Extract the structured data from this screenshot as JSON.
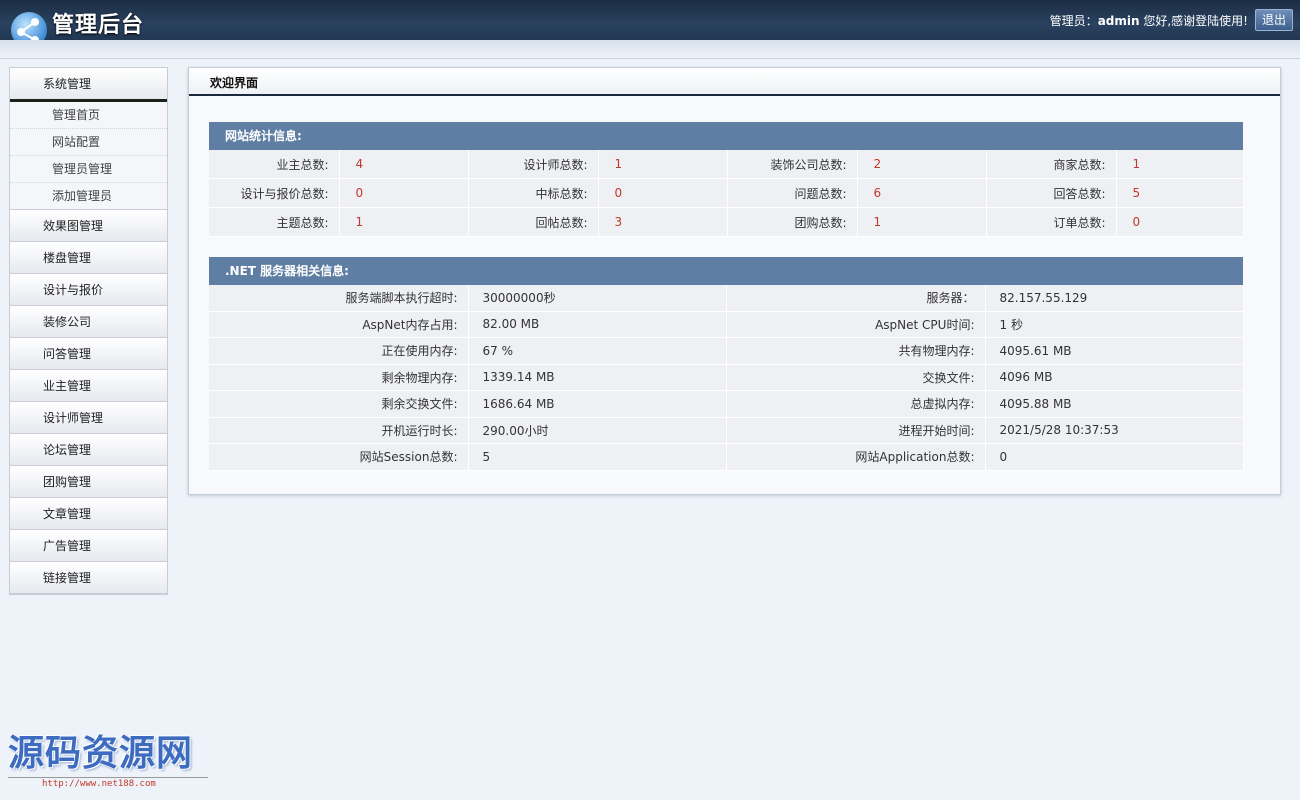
{
  "header": {
    "app_title": "管理后台",
    "welcome_prefix": "管理员：",
    "username": "admin",
    "welcome_suffix": " 您好,感谢登陆使用!",
    "logout_label": "退出"
  },
  "sidebar": {
    "active_group": {
      "label": "系统管理",
      "items": [
        "管理首页",
        "网站配置",
        "管理员管理",
        "添加管理员"
      ]
    },
    "groups": [
      "效果图管理",
      "楼盘管理",
      "设计与报价",
      "装修公司",
      "问答管理",
      "业主管理",
      "设计师管理",
      "论坛管理",
      "团购管理",
      "文章管理",
      "广告管理",
      "链接管理"
    ]
  },
  "main": {
    "title": "欢迎界面",
    "stats_section": {
      "heading": "网站统计信息:",
      "rows": [
        [
          [
            "业主总数:",
            "4"
          ],
          [
            "设计师总数:",
            "1"
          ],
          [
            "装饰公司总数:",
            "2"
          ],
          [
            "商家总数:",
            "1"
          ]
        ],
        [
          [
            "设计与报价总数:",
            "0"
          ],
          [
            "中标总数:",
            "0"
          ],
          [
            "问题总数:",
            "6"
          ],
          [
            "回答总数:",
            "5"
          ]
        ],
        [
          [
            "主题总数:",
            "1"
          ],
          [
            "回帖总数:",
            "3"
          ],
          [
            "团购总数:",
            "1"
          ],
          [
            "订单总数:",
            "0"
          ]
        ]
      ]
    },
    "server_section": {
      "heading": ".NET 服务器相关信息:",
      "rows": [
        [
          [
            "服务端脚本执行超时:",
            "30000000秒"
          ],
          [
            "服务器：",
            "82.157.55.129"
          ]
        ],
        [
          [
            "AspNet内存占用:",
            "82.00 MB"
          ],
          [
            "AspNet CPU时间:",
            "1 秒"
          ]
        ],
        [
          [
            "正在使用内存:",
            "67 %"
          ],
          [
            "共有物理内存:",
            "4095.61 MB"
          ]
        ],
        [
          [
            "剩余物理内存:",
            "1339.14 MB"
          ],
          [
            "交换文件:",
            "4096 MB"
          ]
        ],
        [
          [
            "剩余交换文件:",
            "1686.64 MB"
          ],
          [
            "总虚拟内存:",
            "4095.88 MB"
          ]
        ],
        [
          [
            "开机运行时长:",
            "290.00小时"
          ],
          [
            "进程开始时间:",
            "2021/5/28 10:37:53"
          ]
        ],
        [
          [
            "网站Session总数:",
            "5"
          ],
          [
            "网站Application总数:",
            "0"
          ]
        ]
      ]
    }
  },
  "watermark": {
    "text": "源码资源网",
    "url": "http://www.net188.com"
  },
  "colors": {
    "header_bg": "#223752",
    "section_head_bg": "#5f7ea3",
    "stat_value": "#c0392b"
  },
  "icons": {
    "logo": "share-nodes-logo-icon"
  }
}
